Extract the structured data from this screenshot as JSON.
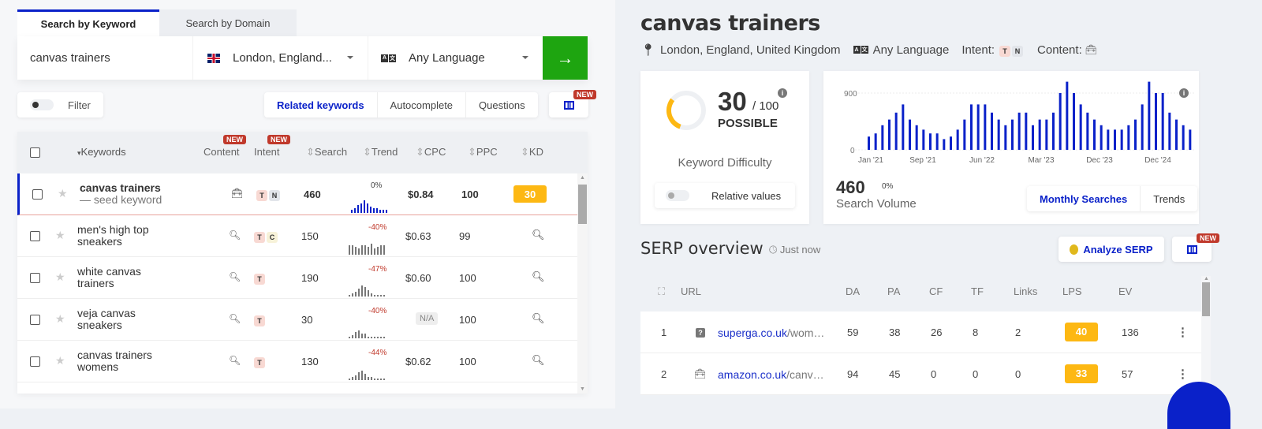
{
  "search": {
    "tabs": [
      {
        "label": "Search by Keyword",
        "active": true
      },
      {
        "label": "Search by Domain",
        "active": false
      }
    ],
    "keyword_value": "canvas trainers",
    "location": "London, England...",
    "language": "Any Language",
    "go_icon": "arrow-right-icon"
  },
  "filters": {
    "filter_label": "Filter",
    "modes": [
      "Related keywords",
      "Autocomplete",
      "Questions"
    ],
    "active_mode": "Related keywords",
    "new_badge": "NEW"
  },
  "keywords_table": {
    "columns": [
      "Keywords",
      "Content",
      "Intent",
      "Search",
      "Trend",
      "CPC",
      "PPC",
      "KD"
    ],
    "new_badge": "NEW",
    "rows": [
      {
        "keyword": "canvas trainers",
        "sub": "— seed keyword",
        "content": "briefcase",
        "intent": [
          "T",
          "N"
        ],
        "search": "460",
        "trend": "0%",
        "trend_bars": [
          2,
          3,
          5,
          6,
          8,
          6,
          4,
          3,
          3,
          2,
          2,
          2
        ],
        "cpc": "$0.84",
        "ppc": "100",
        "kd": "30",
        "seed": true
      },
      {
        "keyword": "men's high top",
        "sub": "sneakers",
        "content": "search",
        "intent": [
          "T",
          "C"
        ],
        "search": "150",
        "trend": "-40%",
        "trend_bars": [
          6,
          6,
          5,
          4,
          6,
          6,
          5,
          7,
          4,
          5,
          6,
          6
        ],
        "cpc": "$0.63",
        "ppc": "99",
        "kd": ""
      },
      {
        "keyword": "white canvas",
        "sub": "trainers",
        "content": "search",
        "intent": [
          "T"
        ],
        "search": "190",
        "trend": "-47%",
        "trend_bars": [
          1,
          2,
          3,
          5,
          7,
          6,
          4,
          2,
          1,
          1,
          1,
          1
        ],
        "cpc": "$0.60",
        "ppc": "100",
        "kd": ""
      },
      {
        "keyword": "veja canvas",
        "sub": "sneakers",
        "content": "search",
        "intent": [
          "T"
        ],
        "search": "30",
        "trend": "-40%",
        "trend_bars": [
          1,
          2,
          4,
          5,
          3,
          3,
          1,
          1,
          1,
          1,
          1,
          1
        ],
        "cpc": "N/A",
        "ppc": "100",
        "kd": ""
      },
      {
        "keyword": "canvas trainers",
        "sub": "womens",
        "content": "search",
        "intent": [
          "T"
        ],
        "search": "130",
        "trend": "-44%",
        "trend_bars": [
          1,
          2,
          3,
          5,
          6,
          4,
          2,
          2,
          1,
          1,
          1,
          1
        ],
        "cpc": "$0.62",
        "ppc": "100",
        "kd": ""
      }
    ]
  },
  "overview": {
    "title": "canvas trainers",
    "location": "London, England, United Kingdom",
    "language": "Any Language",
    "intent_label": "Intent:",
    "intent": [
      "T",
      "N"
    ],
    "content_label": "Content:"
  },
  "difficulty": {
    "score": "30",
    "max": "/ 100",
    "score_fraction": 0.3,
    "label": "POSSIBLE",
    "caption": "Keyword Difficulty",
    "relative_label": "Relative values",
    "color": "#fdb813"
  },
  "volume": {
    "value": "460",
    "change": "0%",
    "caption": "Search Volume",
    "buttons": [
      "Monthly Searches",
      "Trends"
    ],
    "active": "Monthly Searches"
  },
  "chart_data": {
    "type": "bar",
    "title": "",
    "ylim": [
      0,
      900
    ],
    "y_ticks": [
      "0",
      "900"
    ],
    "x_tick_labels": [
      "Jan '21",
      "Sep '21",
      "Jun '22",
      "Mar '23",
      "Dec '23",
      "Dec '24"
    ],
    "color": "#0a21c9",
    "values": [
      210,
      260,
      390,
      480,
      590,
      720,
      480,
      390,
      320,
      260,
      260,
      170,
      210,
      320,
      480,
      720,
      720,
      720,
      590,
      480,
      390,
      480,
      590,
      590,
      390,
      480,
      480,
      590,
      900,
      1080,
      900,
      720,
      590,
      480,
      390,
      320,
      320,
      320,
      390,
      480,
      720,
      1080,
      900,
      900,
      590,
      480,
      390,
      320
    ]
  },
  "serp": {
    "title": "SERP overview",
    "updated": "Just now",
    "analyze_label": "Analyze SERP",
    "new_badge": "NEW",
    "columns": [
      "URL",
      "DA",
      "PA",
      "CF",
      "TF",
      "Links",
      "LPS",
      "EV"
    ],
    "rows": [
      {
        "rank": "1",
        "icon": "question",
        "domain": "superga.co.uk",
        "path": "/wom…",
        "da": "59",
        "pa": "38",
        "cf": "26",
        "tf": "8",
        "links": "2",
        "lps": "40",
        "ev": "136"
      },
      {
        "rank": "2",
        "icon": "briefcase",
        "domain": "amazon.co.uk",
        "path": "/canv…",
        "da": "94",
        "pa": "45",
        "cf": "0",
        "tf": "0",
        "links": "0",
        "lps": "33",
        "ev": "57"
      }
    ]
  }
}
